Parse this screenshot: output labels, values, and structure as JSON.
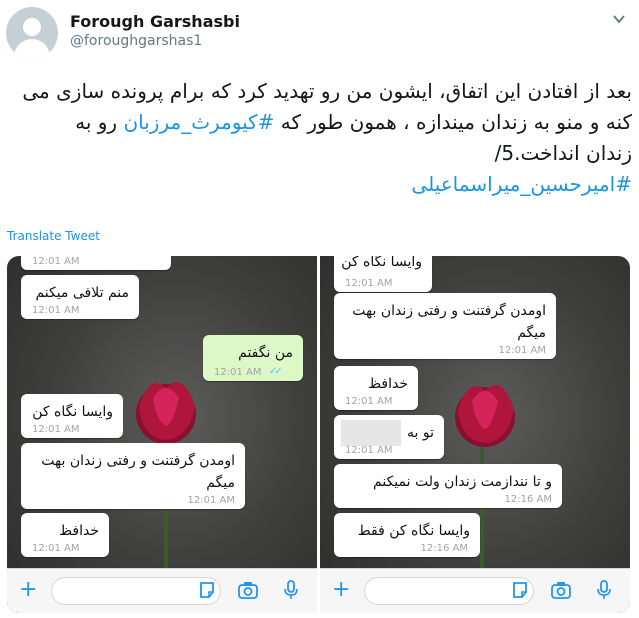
{
  "user": {
    "name": "Forough Garshasbi",
    "handle": "@foroughgarshas1"
  },
  "tweet": {
    "line1": "بعد از افتادن این اتفاق، ایشون من رو تهدید کرد که برام پرونده سازی می",
    "line2_before": "کنه و منو به زندان میندازه ، همون طور که ",
    "line2_hashtag": "#کیومرث_مرزبان",
    "line2_after": " رو به",
    "line3": "زندان انداخت.5/",
    "hashtag2": "#امیرحسین_میراسماعیلی"
  },
  "translate_label": "Translate Tweet",
  "colors": {
    "accent": "#1b95e0",
    "whatsapp_icon": "#2196f3",
    "outgoing_bubble": "#dcf8c6",
    "tick": "#4fc3f7"
  },
  "left_chat": {
    "messages": [
      {
        "text": "",
        "time": "12:01 AM",
        "direction": "in"
      },
      {
        "text": "منم تلافی میکنم",
        "time": "12:01 AM",
        "direction": "in"
      },
      {
        "text": "من نگفتم",
        "time": "12:01 AM",
        "direction": "out",
        "status": "read"
      },
      {
        "text": "وایسا نگاه کن",
        "time": "12:01 AM",
        "direction": "in"
      },
      {
        "text": "اومدن گرفتنت و رفتی زندان بهت",
        "text2": "میگم",
        "time": "12:01 AM",
        "direction": "in"
      },
      {
        "text": "خدافظ",
        "time": "12:01 AM",
        "direction": "in"
      }
    ]
  },
  "right_chat": {
    "messages": [
      {
        "text": "وایسا نگاه کن",
        "time": "12:01 AM",
        "direction": "in"
      },
      {
        "text": "اومدن گرفتنت و رفتی زندان بهت",
        "text2": "میگم",
        "time": "12:01 AM",
        "direction": "in"
      },
      {
        "text": "خدافظ",
        "time": "12:01 AM",
        "direction": "in"
      },
      {
        "text": "تو به",
        "time": "12:01 AM",
        "direction": "in",
        "redacted": true
      },
      {
        "text": "و تا نندازمت زندان ولت نمیکنم",
        "time": "12:16 AM",
        "direction": "in"
      },
      {
        "text": "وایسا نگاه کن فقط",
        "time": "12:16 AM",
        "direction": "in"
      }
    ]
  },
  "icons": [
    "chevron-down-icon",
    "plus-icon",
    "sticker-icon",
    "camera-icon",
    "microphone-icon",
    "read-ticks-icon"
  ]
}
